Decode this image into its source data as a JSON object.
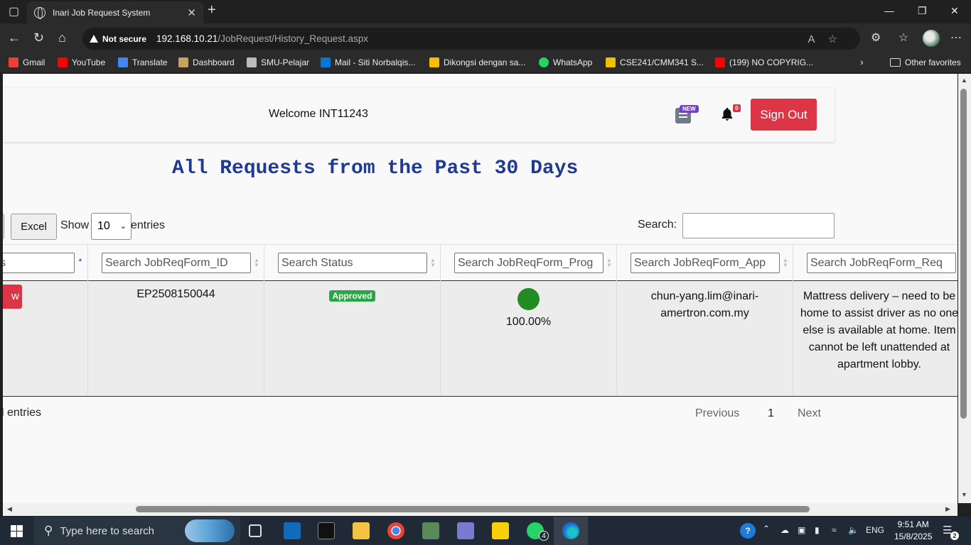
{
  "browser": {
    "tab_title": "Inari Job Request System",
    "security_label": "Not secure",
    "url_host": "192.168.10.21",
    "url_path": "/JobRequest/History_Request.aspx"
  },
  "bookmarks": [
    {
      "label": "Gmail",
      "icon": "gmail-icon",
      "color": "#ea4335"
    },
    {
      "label": "YouTube",
      "icon": "youtube-icon",
      "color": "#ff0000"
    },
    {
      "label": "Translate",
      "icon": "translate-icon",
      "color": "#4285f4"
    },
    {
      "label": "Dashboard",
      "icon": "dashboard-icon",
      "color": "#c8a060"
    },
    {
      "label": "SMU-Pelajar",
      "icon": "smu-icon",
      "color": "#bbbbbb"
    },
    {
      "label": "Mail - Siti Norbalqis...",
      "icon": "outlook-icon",
      "color": "#0078d4"
    },
    {
      "label": "Dikongsi dengan sa...",
      "icon": "drive-icon",
      "color": "#fbbc04"
    },
    {
      "label": "WhatsApp",
      "icon": "whatsapp-icon",
      "color": "#25d366"
    },
    {
      "label": "CSE241/CMM341 S...",
      "icon": "elearning-icon",
      "color": "#f0c000"
    },
    {
      "label": "(199) NO COPYRIG...",
      "icon": "youtube-icon",
      "color": "#ff0000"
    }
  ],
  "other_favorites": "Other favorites",
  "header": {
    "welcome": "Welcome INT11243",
    "new_badge": "NEW",
    "notif_count": "0",
    "signout": "Sign Out"
  },
  "page_title": "All Requests from the Past 30 Days",
  "controls": {
    "excel": "Excel",
    "show": "Show",
    "length_value": "10",
    "entries": "entries",
    "search_label": "Search:"
  },
  "columns": [
    {
      "placeholder": "Search Status",
      "partial": "s"
    },
    {
      "placeholder": "Search JobReqForm_ID"
    },
    {
      "placeholder": "Search Status"
    },
    {
      "placeholder": "Search JobReqForm_Prog"
    },
    {
      "placeholder": "Search JobReqForm_App"
    },
    {
      "placeholder": "Search JobReqForm_Req"
    }
  ],
  "row": {
    "action_partial": "w",
    "id": "EP2508150044",
    "status": "Approved",
    "progress": "100.00%",
    "approver": "chun-yang.lim@inari-amertron.com.my",
    "reason": "Mattress delivery – need to be home to assist driver as no one else is available at home. Item cannot be left unattended at apartment lobby."
  },
  "footer": {
    "info": "l entries",
    "previous": "Previous",
    "page": "1",
    "next": "Next"
  },
  "taskbar": {
    "search_placeholder": "Type here to search",
    "lang": "ENG",
    "time": "9:51 AM",
    "date": "15/8/2025",
    "whatsapp_count": "4",
    "notif_count": "2"
  }
}
